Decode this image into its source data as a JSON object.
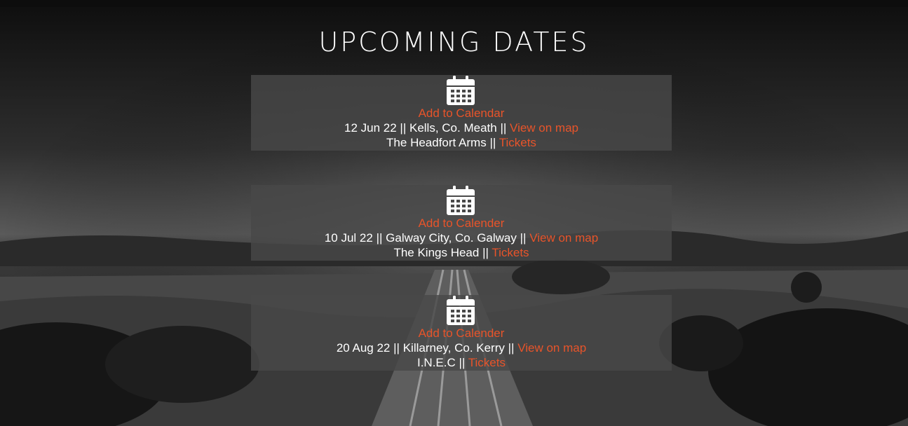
{
  "page": {
    "title": "UPCOMING DATES"
  },
  "theme": {
    "link_color": "#e8542a",
    "card_bg": "#484848",
    "text_color": "#ffffff"
  },
  "separator": "||",
  "events": [
    {
      "icon": "calendar-icon",
      "calendar_label": "Add to Calendar",
      "date": "12 Jun 22",
      "location": "Kells, Co. Meath",
      "map_label": "View on map",
      "venue": "The Headfort Arms",
      "tickets_label": "Tickets"
    },
    {
      "icon": "calendar-icon",
      "calendar_label": "Add to Calender",
      "date": "10 Jul 22",
      "location": "Galway City, Co. Galway",
      "map_label": "View on map",
      "venue": "The Kings Head",
      "tickets_label": "Tickets"
    },
    {
      "icon": "calendar-icon",
      "calendar_label": "Add to Calender",
      "date": "20 Aug 22",
      "location": "Killarney, Co. Kerry",
      "map_label": "View on map",
      "venue": "I.N.E.C",
      "tickets_label": "Tickets"
    }
  ]
}
